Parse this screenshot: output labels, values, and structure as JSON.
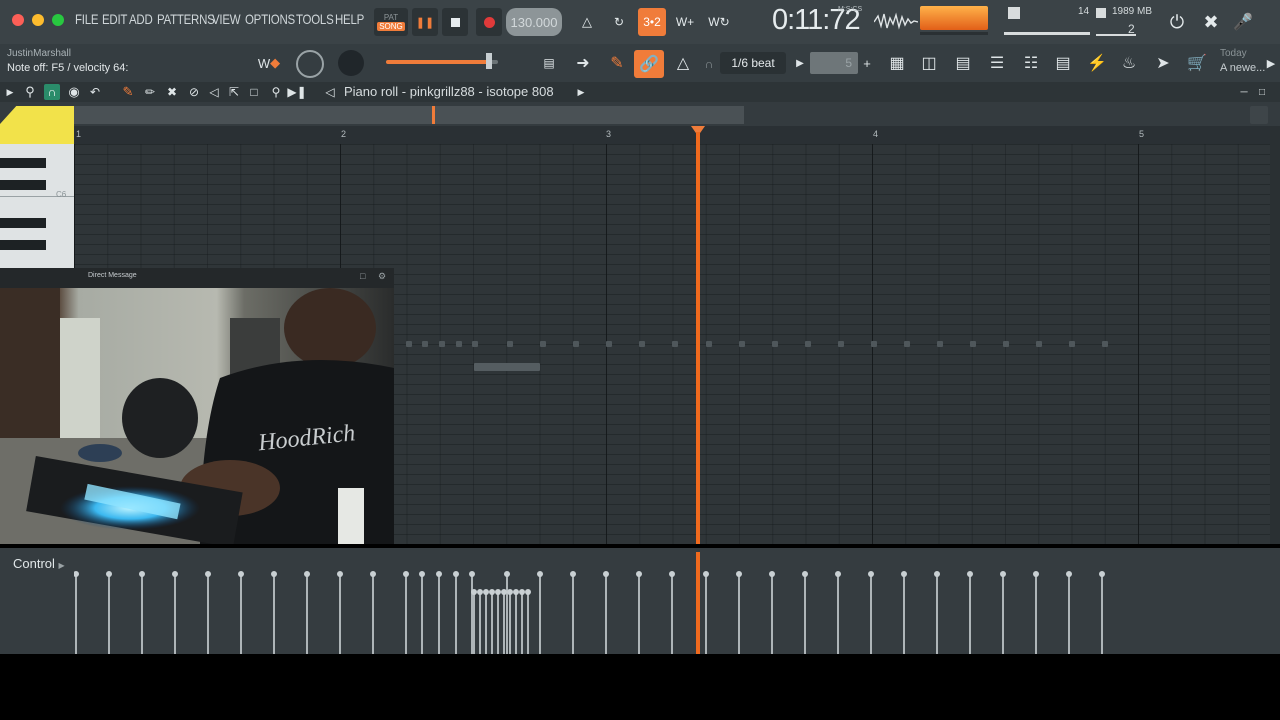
{
  "window": {
    "traffic_lights": [
      "#fc5f57",
      "#fdbc2e",
      "#28c840"
    ]
  },
  "menu": {
    "items": [
      "FILE",
      "EDIT",
      "ADD",
      "PATTERNS",
      "VIEW",
      "OPTIONS",
      "TOOLS",
      "HELP"
    ]
  },
  "transport": {
    "mode_top": "PAT",
    "mode_bottom": "SONG",
    "tempo": "130.000",
    "time": "0:11:72",
    "time_unit": "M:S:CS",
    "accent_color": "#f07c3a"
  },
  "monitor": {
    "cpu_value": "14",
    "ram_value": "1989 MB",
    "polyphony": "2"
  },
  "hint_bar": {
    "user": "JustinMarshall",
    "message": "Note off: F5 / velocity 64:"
  },
  "snap": {
    "value": "1/6 beat",
    "step_value": "5"
  },
  "news": {
    "heading": "Today",
    "text": "A newe..."
  },
  "piano_roll": {
    "title": "Piano roll - pinkgrillz88 - isotope 808",
    "bar_numbers": [
      "1",
      "2",
      "3",
      "4",
      "5"
    ],
    "key_label": "C6",
    "playhead_color": "#f06a1e"
  },
  "webcam": {
    "title": "Direct Message",
    "shirt_text": "HoodRich"
  },
  "control_lane": {
    "label": "Control"
  }
}
